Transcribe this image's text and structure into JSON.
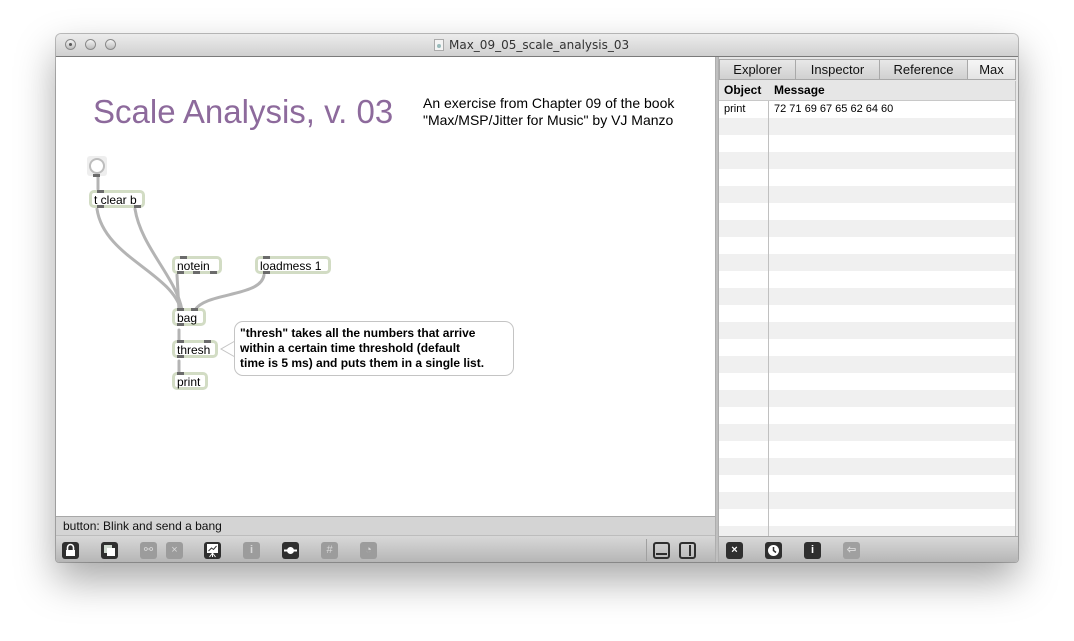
{
  "window": {
    "title": "Max_09_05_scale_analysis_03"
  },
  "patcher": {
    "title": "Scale Analysis, v. 03",
    "subtitle_lines": [
      "An exercise from Chapter 09 of the book",
      "\"Max/MSP/Jitter for Music\" by VJ Manzo"
    ],
    "objects": {
      "trigger": "t clear b",
      "notein": "notein",
      "loadmess": "loadmess 1",
      "bag": "bag",
      "thresh": "thresh",
      "print": "print"
    },
    "comment_lines": [
      "\"thresh\" takes all the numbers that arrive",
      "within a certain time threshold (default",
      "time is 5 ms) and puts them in a single list."
    ],
    "title_color": "#8d6a9c",
    "object_border_color": "#d2dcc4"
  },
  "status_bar": {
    "text": "button: Blink and send a bang"
  },
  "toolbar": {
    "buttons": [
      {
        "name": "lock-icon",
        "glyph": "🔒",
        "enabled": true
      },
      {
        "name": "presentation-icon",
        "glyph": "◧",
        "enabled": true
      },
      {
        "name": "binoculars-icon",
        "glyph": "⚯",
        "enabled": false
      },
      {
        "name": "clear-icon",
        "glyph": "×",
        "enabled": false
      },
      {
        "name": "easel-icon",
        "glyph": "⟋",
        "enabled": true
      },
      {
        "name": "info-icon",
        "glyph": "i",
        "enabled": false
      },
      {
        "name": "patch-cord-icon",
        "glyph": "●",
        "enabled": true
      },
      {
        "name": "grid-icon",
        "glyph": "#",
        "enabled": false
      },
      {
        "name": "dsp-icon",
        "glyph": "◔",
        "enabled": false
      }
    ],
    "right_buttons": [
      {
        "name": "bottom-panel-icon"
      },
      {
        "name": "side-panel-icon"
      }
    ]
  },
  "sidebar": {
    "tabs": [
      {
        "label": "Explorer",
        "active": false
      },
      {
        "label": "Inspector",
        "active": false
      },
      {
        "label": "Reference",
        "active": false
      },
      {
        "label": "Max",
        "active": true
      }
    ],
    "console": {
      "columns": [
        "Object",
        "Message"
      ],
      "rows": [
        {
          "object": "print",
          "message": "72 71 69 67 65 62 64 60"
        }
      ]
    },
    "toolbar": [
      {
        "name": "clear-console-icon",
        "glyph": "×",
        "enabled": true
      },
      {
        "name": "timestamp-icon",
        "glyph": "◷",
        "enabled": true
      },
      {
        "name": "info-icon",
        "glyph": "i",
        "enabled": true
      },
      {
        "name": "back-arrow-icon",
        "glyph": "⇦",
        "enabled": false
      }
    ]
  }
}
